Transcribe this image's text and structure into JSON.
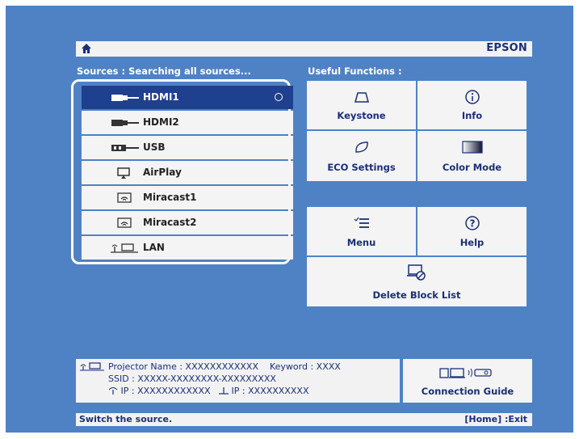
{
  "header": {
    "brand": "EPSON",
    "home_icon": "home-icon"
  },
  "sources": {
    "label": "Sources :  Searching all sources...",
    "items": [
      {
        "label": "HDMI1",
        "icon": "hdmi-icon",
        "selected": true
      },
      {
        "label": "HDMI2",
        "icon": "hdmi-icon",
        "selected": false
      },
      {
        "label": "USB",
        "icon": "usb-icon",
        "selected": false
      },
      {
        "label": "AirPlay",
        "icon": "airplay-icon",
        "selected": false
      },
      {
        "label": "Miracast1",
        "icon": "miracast-icon",
        "selected": false
      },
      {
        "label": "Miracast2",
        "icon": "miracast-icon",
        "selected": false
      },
      {
        "label": "LAN",
        "icon": "lan-icon",
        "selected": false
      }
    ]
  },
  "functions": {
    "label": "Useful Functions :",
    "keystone": "Keystone",
    "info": "Info",
    "eco": "ECO Settings",
    "color_mode": "Color Mode",
    "menu": "Menu",
    "help": "Help",
    "delete_block": "Delete Block List"
  },
  "info": {
    "projector_name_label": "Projector Name :",
    "projector_name": "XXXXXXXXXXXX",
    "keyword_label": "Keyword :",
    "keyword": "XXXX",
    "ssid_label": "SSID :",
    "ssid": "XXXXX-XXXXXXXX-XXXXXXXXX",
    "ip_label": "IP :",
    "ip": "XXXXXXXXXXXX",
    "wired_ip_label": "IP :",
    "wired_ip": "XXXXXXXXXX"
  },
  "guide": {
    "label": "Connection Guide"
  },
  "status": {
    "left": "Switch the source.",
    "right": "[Home] :Exit"
  },
  "colors": {
    "background": "#4f82c4",
    "selected": "#1f3f8f",
    "text": "#1a2f7a"
  }
}
